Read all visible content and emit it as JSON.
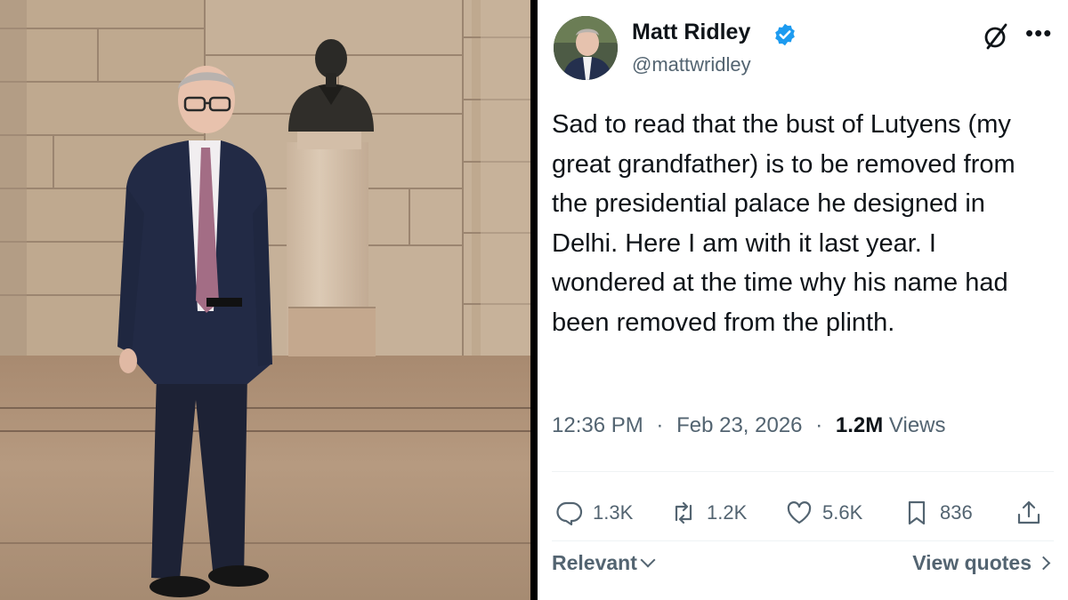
{
  "post": {
    "author_name": "Matt Ridley",
    "author_handle": "@mattwridley",
    "verified": true,
    "body": "Sad to read that the bust of Lutyens (my great grandfather) is to be removed from the presidential palace he designed in Delhi. Here I am with it last year. I wondered at the time why his name had been removed from the plinth.",
    "time": "12:36 PM",
    "date": "Feb 23, 2026",
    "separator": "·",
    "views_count": "1.2M",
    "views_label": "Views"
  },
  "actions": {
    "replies": "1.3K",
    "reposts": "1.2K",
    "likes": "5.6K",
    "bookmarks": "836"
  },
  "footer": {
    "sort_label": "Relevant",
    "view_quotes_label": "View quotes"
  },
  "icons": {
    "verified": "verified-badge-icon",
    "grok": "grok-icon",
    "more": "more-icon",
    "reply": "reply-icon",
    "repost": "repost-icon",
    "like": "heart-icon",
    "bookmark": "bookmark-icon",
    "share": "share-icon"
  },
  "colors": {
    "verified_blue": "#1d9bf0",
    "secondary_text": "#536471",
    "primary_text": "#0f1419"
  }
}
